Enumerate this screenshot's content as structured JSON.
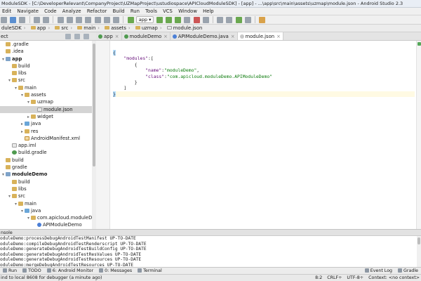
{
  "window": {
    "title": "ModuleSDK - [C:\\DeveloperRelevant\\CompanyProject\\UZMapProject\\ustudiospace\\APICloudModuleSDK] - [app] - ...\\app\\src\\main\\assets\\uzmap\\module.json - Android Studio 2.3"
  },
  "menu": [
    "Edit",
    "Navigate",
    "Code",
    "Analyze",
    "Refactor",
    "Build",
    "Run",
    "Tools",
    "VCS",
    "Window",
    "Help"
  ],
  "toolbar": {
    "run_config": "app"
  },
  "breadcrumbs": [
    "duleSDK",
    "app",
    "src",
    "main",
    "assets",
    "uzmap",
    "module.json"
  ],
  "project_panel": {
    "title": "ect"
  },
  "tabs": [
    {
      "label": "app",
      "icon": "gradle-icon",
      "active": false
    },
    {
      "label": "moduleDemo",
      "icon": "gradle-icon",
      "active": false
    },
    {
      "label": "APIModuleDemo.java",
      "icon": "class-icon",
      "active": false
    },
    {
      "label": "module.json",
      "icon": "json-file-icon",
      "active": true
    }
  ],
  "tree": [
    {
      "label": ".gradle",
      "level": 0,
      "arrow": "",
      "icon": "folder",
      "bold": false,
      "selected": false
    },
    {
      "label": ".idea",
      "level": 0,
      "arrow": "",
      "icon": "folder",
      "bold": false,
      "selected": false
    },
    {
      "label": "app",
      "level": 0,
      "arrow": "▾",
      "icon": "module",
      "bold": true,
      "selected": false
    },
    {
      "label": "build",
      "level": 1,
      "arrow": "",
      "icon": "folder",
      "bold": false,
      "selected": false
    },
    {
      "label": "libs",
      "level": 1,
      "arrow": "",
      "icon": "folder",
      "bold": false,
      "selected": false
    },
    {
      "label": "src",
      "level": 1,
      "arrow": "▾",
      "icon": "folder",
      "bold": false,
      "selected": false
    },
    {
      "label": "main",
      "level": 2,
      "arrow": "▾",
      "icon": "folder",
      "bold": false,
      "selected": false
    },
    {
      "label": "assets",
      "level": 3,
      "arrow": "▾",
      "icon": "folder",
      "bold": false,
      "selected": false
    },
    {
      "label": "uzmap",
      "level": 4,
      "arrow": "▾",
      "icon": "folder",
      "bold": false,
      "selected": false
    },
    {
      "label": "module.json",
      "level": 5,
      "arrow": "",
      "icon": "file",
      "bold": false,
      "selected": true
    },
    {
      "label": "widget",
      "level": 4,
      "arrow": "▸",
      "icon": "folder",
      "bold": false,
      "selected": false
    },
    {
      "label": "java",
      "level": 3,
      "arrow": "▸",
      "icon": "src",
      "bold": false,
      "selected": false
    },
    {
      "label": "res",
      "level": 3,
      "arrow": "▸",
      "icon": "folder",
      "bold": false,
      "selected": false
    },
    {
      "label": "AndroidManifest.xml",
      "level": 3,
      "arrow": "",
      "icon": "xml",
      "bold": false,
      "selected": false
    },
    {
      "label": "app.iml",
      "level": 1,
      "arrow": "",
      "icon": "file",
      "bold": false,
      "selected": false
    },
    {
      "label": "build.gradle",
      "level": 1,
      "arrow": "",
      "icon": "gradle",
      "bold": false,
      "selected": false
    },
    {
      "label": "build",
      "level": 0,
      "arrow": "",
      "icon": "folder",
      "bold": false,
      "selected": false
    },
    {
      "label": "gradle",
      "level": 0,
      "arrow": "",
      "icon": "folder",
      "bold": false,
      "selected": false
    },
    {
      "label": "moduleDemo",
      "level": 0,
      "arrow": "▾",
      "icon": "module",
      "bold": true,
      "selected": false
    },
    {
      "label": "build",
      "level": 1,
      "arrow": "",
      "icon": "folder",
      "bold": false,
      "selected": false
    },
    {
      "label": "libs",
      "level": 1,
      "arrow": "",
      "icon": "folder",
      "bold": false,
      "selected": false
    },
    {
      "label": "src",
      "level": 1,
      "arrow": "▾",
      "icon": "folder",
      "bold": false,
      "selected": false
    },
    {
      "label": "main",
      "level": 2,
      "arrow": "▾",
      "icon": "folder",
      "bold": false,
      "selected": false
    },
    {
      "label": "java",
      "level": 3,
      "arrow": "▾",
      "icon": "src",
      "bold": false,
      "selected": false
    },
    {
      "label": "com.apicloud.moduleDemo",
      "level": 4,
      "arrow": "▾",
      "icon": "folder",
      "bold": false,
      "selected": false
    },
    {
      "label": "APIModuleDemo",
      "level": 5,
      "arrow": "",
      "icon": "clazz",
      "bold": false,
      "selected": false
    },
    {
      "label": "DemoActivity",
      "level": 5,
      "arrow": "",
      "icon": "clazz",
      "bold": false,
      "selected": false
    }
  ],
  "editor": {
    "lines": [
      [
        {
          "t": "{",
          "c": "p brace-hi"
        }
      ],
      [
        {
          "t": "    ",
          "c": "p"
        },
        {
          "t": "\"modules\"",
          "c": "k"
        },
        {
          "t": ":[",
          "c": "p"
        }
      ],
      [
        {
          "t": "        {",
          "c": "p"
        }
      ],
      [
        {
          "t": "            ",
          "c": "p"
        },
        {
          "t": "\"name\"",
          "c": "k"
        },
        {
          "t": ":",
          "c": "p"
        },
        {
          "t": "\"moduleDemo\"",
          "c": "s"
        },
        {
          "t": ",",
          "c": "p"
        }
      ],
      [
        {
          "t": "            ",
          "c": "p"
        },
        {
          "t": "\"class\"",
          "c": "k"
        },
        {
          "t": ":",
          "c": "p"
        },
        {
          "t": "\"com.apicloud.moduleDemo.APIModuleDemo\"",
          "c": "s"
        }
      ],
      [
        {
          "t": "        }",
          "c": "p"
        }
      ],
      [
        {
          "t": "    ]",
          "c": "p"
        }
      ],
      [
        {
          "t": "}",
          "c": "p brace-hi"
        }
      ]
    ],
    "current_line": 7
  },
  "console": {
    "title": "nsole",
    "lines": [
      "oduleDemo:processDebugAndroidTestManifest UP-TO-DATE",
      "oduleDemo:compileDebugAndroidTestRenderscript UP-TO-DATE",
      "oduleDemo:generateDebugAndroidTestBuildConfig UP-TO-DATE",
      "oduleDemo:generateDebugAndroidTestResValues UP-TO-DATE",
      "oduleDemo:generateDebugAndroidTestResources UP-TO-DATE",
      "oduleDemo:mergeDebugAndroidTestResources UP-TO-DATE"
    ]
  },
  "tool_windows": [
    {
      "label": "Run",
      "icon": "run-icon"
    },
    {
      "label": "TODO",
      "icon": "todo-icon"
    },
    {
      "label": "6: Android Monitor",
      "icon": "android-icon"
    },
    {
      "label": "0: Messages",
      "icon": "messages-icon"
    },
    {
      "label": "Terminal",
      "icon": "terminal-icon"
    }
  ],
  "tool_windows_right": [
    {
      "label": "Event Log",
      "icon": "event-log-icon"
    },
    {
      "label": "Gradle",
      "icon": "gradle-icon"
    }
  ],
  "status": {
    "message": "ind to local 8608 for debugger (a minute ago)",
    "position": "8:2",
    "line_sep": "CRLF÷",
    "encoding": "UTF-8÷",
    "context": "Context: <no context>"
  },
  "colors": {
    "keyword": "#660e7a",
    "string": "#0b7a0b",
    "selection": "#d4d4d4"
  }
}
